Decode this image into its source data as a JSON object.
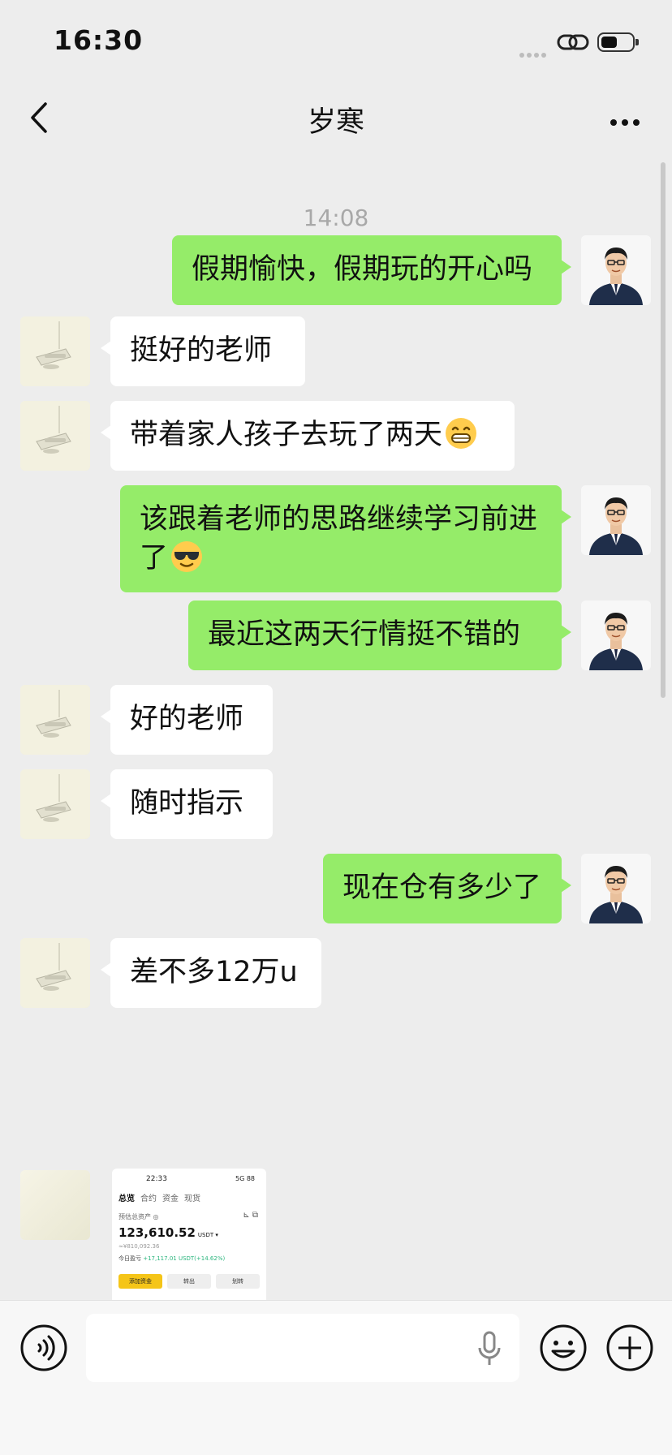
{
  "status_bar": {
    "time": "16:30"
  },
  "nav": {
    "title": "岁寒"
  },
  "chat": {
    "timestamp": "14:08",
    "messages": [
      {
        "side": "right",
        "text": "假期愉快，假期玩的开心吗"
      },
      {
        "side": "left",
        "text": "挺好的老师"
      },
      {
        "side": "left",
        "text": "带着家人孩子去玩了两天",
        "emoji": "grinning-face-emoji"
      },
      {
        "side": "right",
        "text": "该跟着老师的思路继续学习前进了",
        "emoji": "sunglasses-face-emoji"
      },
      {
        "side": "right",
        "text": "最近这两天行情挺不错的"
      },
      {
        "side": "left",
        "text": "好的老师"
      },
      {
        "side": "left",
        "text": "随时指示"
      },
      {
        "side": "right",
        "text": "现在仓有多少了"
      },
      {
        "side": "left",
        "text": "差不多12万u"
      }
    ],
    "image_message": {
      "time": "22:33",
      "status": "5G 88",
      "tabs": [
        "总览",
        "合约",
        "资金",
        "现货"
      ],
      "label": "预估总资产 ◎",
      "amount": "123,610.52",
      "unit": "USDT ▾",
      "cny": "≈¥810,092.36",
      "pnl_label": "今日盈亏",
      "pnl_value": "+17,117.01 USDT(+14.62%)",
      "buttons": [
        "添加资金",
        "转出",
        "划转"
      ]
    }
  },
  "colors": {
    "sent_bubble": "#95ec69",
    "received_bubble": "#ffffff",
    "background": "#ededed"
  },
  "icons": [
    "back-icon",
    "more-icon",
    "voice-icon",
    "microphone-icon",
    "emoji-icon",
    "plus-icon"
  ]
}
